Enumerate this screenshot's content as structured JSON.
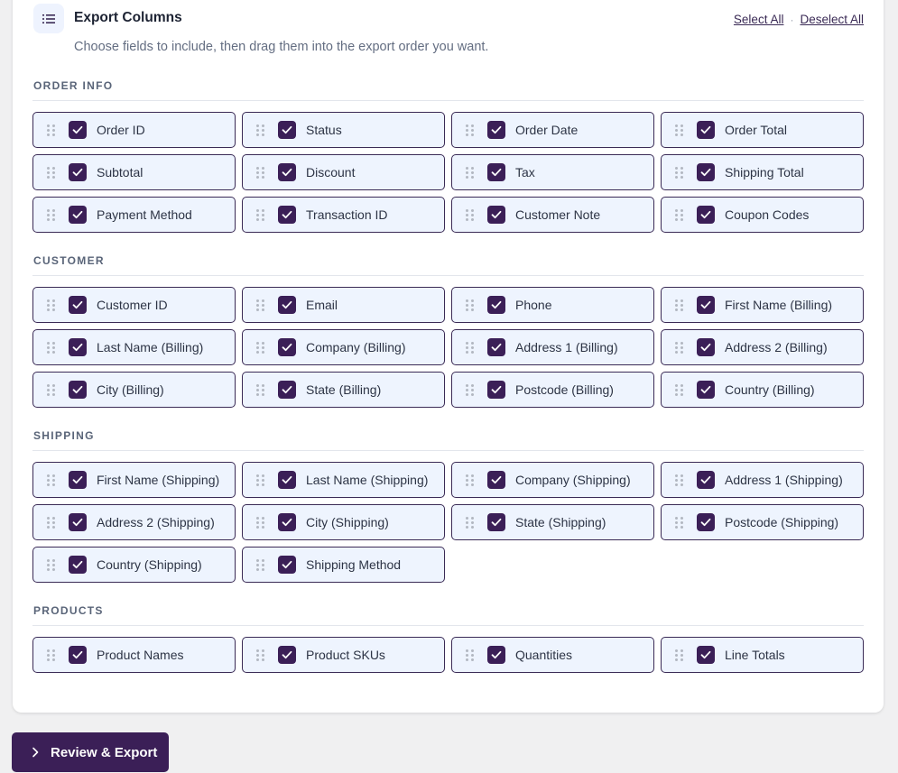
{
  "header": {
    "title": "Export Columns",
    "subtitle": "Choose fields to include, then drag them into the export order you want.",
    "select_all": "Select All",
    "separator": "·",
    "deselect_all": "Deselect All",
    "icon": "list-icon"
  },
  "colors": {
    "accent": "#3b1f57",
    "chip_background": "#eef4fe",
    "page_background": "#f0f0f1"
  },
  "sections": [
    {
      "title": "ORDER INFO",
      "items": [
        {
          "label": "Order ID",
          "checked": true
        },
        {
          "label": "Status",
          "checked": true
        },
        {
          "label": "Order Date",
          "checked": true
        },
        {
          "label": "Order Total",
          "checked": true
        },
        {
          "label": "Subtotal",
          "checked": true
        },
        {
          "label": "Discount",
          "checked": true
        },
        {
          "label": "Tax",
          "checked": true
        },
        {
          "label": "Shipping Total",
          "checked": true
        },
        {
          "label": "Payment Method",
          "checked": true
        },
        {
          "label": "Transaction ID",
          "checked": true
        },
        {
          "label": "Customer Note",
          "checked": true
        },
        {
          "label": "Coupon Codes",
          "checked": true
        }
      ]
    },
    {
      "title": "CUSTOMER",
      "items": [
        {
          "label": "Customer ID",
          "checked": true
        },
        {
          "label": "Email",
          "checked": true
        },
        {
          "label": "Phone",
          "checked": true
        },
        {
          "label": "First Name (Billing)",
          "checked": true
        },
        {
          "label": "Last Name (Billing)",
          "checked": true
        },
        {
          "label": "Company (Billing)",
          "checked": true
        },
        {
          "label": "Address 1 (Billing)",
          "checked": true
        },
        {
          "label": "Address 2 (Billing)",
          "checked": true
        },
        {
          "label": "City (Billing)",
          "checked": true
        },
        {
          "label": "State (Billing)",
          "checked": true
        },
        {
          "label": "Postcode (Billing)",
          "checked": true
        },
        {
          "label": "Country (Billing)",
          "checked": true
        }
      ]
    },
    {
      "title": "SHIPPING",
      "items": [
        {
          "label": "First Name (Shipping)",
          "checked": true
        },
        {
          "label": "Last Name (Shipping)",
          "checked": true
        },
        {
          "label": "Company (Shipping)",
          "checked": true
        },
        {
          "label": "Address 1 (Shipping)",
          "checked": true
        },
        {
          "label": "Address 2 (Shipping)",
          "checked": true
        },
        {
          "label": "City (Shipping)",
          "checked": true
        },
        {
          "label": "State (Shipping)",
          "checked": true
        },
        {
          "label": "Postcode (Shipping)",
          "checked": true
        },
        {
          "label": "Country (Shipping)",
          "checked": true
        },
        {
          "label": "Shipping Method",
          "checked": true
        }
      ]
    },
    {
      "title": "PRODUCTS",
      "items": [
        {
          "label": "Product Names",
          "checked": true
        },
        {
          "label": "Product SKUs",
          "checked": true
        },
        {
          "label": "Quantities",
          "checked": true
        },
        {
          "label": "Line Totals",
          "checked": true
        }
      ]
    }
  ],
  "footer": {
    "export_label": "Review & Export",
    "export_icon": "chevron-right-icon"
  }
}
